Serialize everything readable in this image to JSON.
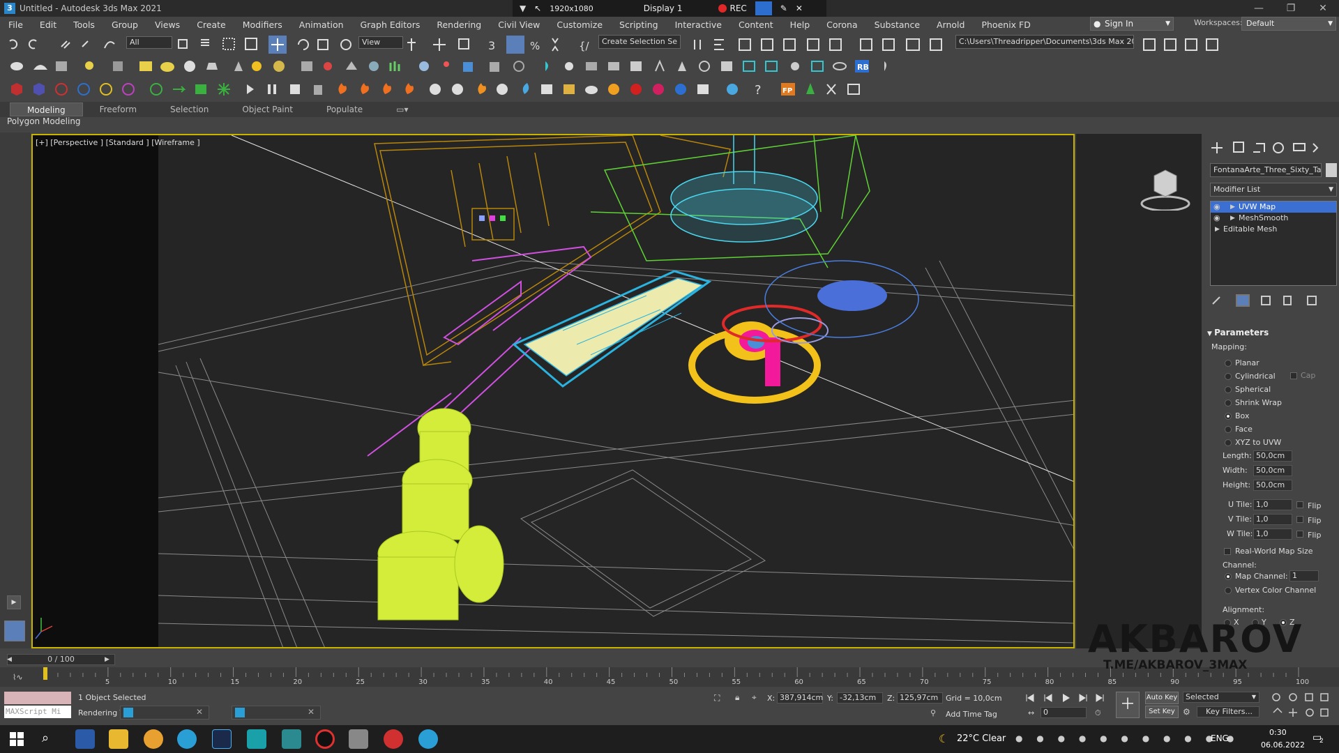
{
  "window": {
    "title": "Untitled - Autodesk 3ds Max 2021",
    "controls": [
      "—",
      "❐",
      "✕"
    ]
  },
  "recorder": {
    "resolution": "1920x1080",
    "display": "Display 1",
    "rec_label": "REC"
  },
  "menu": [
    "File",
    "Edit",
    "Tools",
    "Group",
    "Views",
    "Create",
    "Modifiers",
    "Animation",
    "Graph Editors",
    "Rendering",
    "Civil View",
    "Customize",
    "Scripting",
    "Interactive",
    "Content",
    "Help",
    "Corona",
    "Substance",
    "Arnold",
    "Phoenix FD"
  ],
  "account": {
    "signin": "Sign In",
    "workspaces_label": "Workspaces:",
    "workspace": "Default"
  },
  "toolbar": {
    "selection_filter": "All",
    "reference_coord": "View",
    "named_selection": "Create Selection Se",
    "project_path": "C:\\Users\\Threadripper\\Documents\\3ds Max 2021"
  },
  "ribbon": {
    "tabs": [
      "Modeling",
      "Freeform",
      "Selection",
      "Object Paint",
      "Populate"
    ],
    "active": "Modeling",
    "sub": "Polygon Modeling"
  },
  "viewport": {
    "label": "[+] [Perspective ] [Standard ] [Wireframe ]"
  },
  "command_panel": {
    "object_name": "FontanaArte_Three_Sixty_Table",
    "modifier_list": "Modifier List",
    "stack": [
      {
        "label": "UVW Map",
        "selected": true,
        "visible": true
      },
      {
        "label": "MeshSmooth",
        "selected": false,
        "visible": true
      },
      {
        "label": "Editable Mesh",
        "selected": false,
        "visible": false
      }
    ],
    "parameters": {
      "title": "Parameters",
      "mapping_label": "Mapping:",
      "mapping_options": [
        "Planar",
        "Cylindrical",
        "Spherical",
        "Shrink Wrap",
        "Box",
        "Face",
        "XYZ to UVW"
      ],
      "mapping_selected": "Box",
      "cap_label": "Cap",
      "length_label": "Length:",
      "length": "50,0cm",
      "width_label": "Width:",
      "width": "50,0cm",
      "height_label": "Height:",
      "height": "50,0cm",
      "utile_label": "U Tile:",
      "utile": "1,0",
      "vtile_label": "V Tile:",
      "vtile": "1,0",
      "wtile_label": "W Tile:",
      "wtile": "1,0",
      "flip_label": "Flip",
      "realworld_label": "Real-World Map Size",
      "channel_label": "Channel:",
      "map_channel_label": "Map Channel:",
      "map_channel": "1",
      "vertex_color_label": "Vertex Color Channel",
      "alignment_label": "Alignment:",
      "align_axes": [
        "X",
        "Y",
        "Z"
      ]
    }
  },
  "timeline": {
    "frame_display": "0 / 100",
    "ticks": [
      "5",
      "10",
      "15",
      "20",
      "25",
      "30",
      "35",
      "40",
      "45",
      "50",
      "55",
      "60",
      "65",
      "70",
      "75",
      "80",
      "85",
      "90",
      "95",
      "100"
    ]
  },
  "status": {
    "selection": "1 Object Selected",
    "rendering": "Rendering T",
    "maxscript": "MAXScript Mi",
    "x_label": "X:",
    "x": "387,914cm",
    "y_label": "Y:",
    "y": "-32,13cm",
    "z_label": "Z:",
    "z": "125,97cm",
    "grid": "Grid = 10,0cm",
    "add_time_tag": "Add Time Tag",
    "auto_key": "Auto Key",
    "set_key": "Set Key",
    "key_mode": "Selected",
    "key_filters": "Key Filters...",
    "frame_field": "0"
  },
  "taskbar": {
    "weather": "22°C  Clear",
    "lang": "ENG",
    "time": "0:30",
    "date": "06.06.2022",
    "notif": "2"
  },
  "watermark": {
    "brand": "AKBAROV",
    "handle": "T.ME/AKBAROV_3MAX"
  },
  "colors": {
    "viewport_border": "#c8b400",
    "selected_stack": "#3b6fd1",
    "rec": "#e02828"
  }
}
